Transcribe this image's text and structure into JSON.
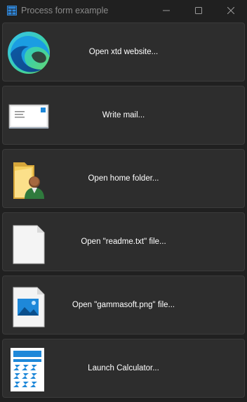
{
  "window": {
    "title": "Process form example",
    "icon": "window-app-icon",
    "controls": [
      "minimize-icon",
      "maximize-icon",
      "close-icon"
    ]
  },
  "buttons": [
    {
      "label": "Open xtd website...",
      "icon": "edge-browser-icon"
    },
    {
      "label": "Write mail...",
      "icon": "envelope-icon"
    },
    {
      "label": "Open home folder...",
      "icon": "user-folder-icon"
    },
    {
      "label": "Open \"readme.txt\" file...",
      "icon": "text-file-icon"
    },
    {
      "label": "Open \"gammasoft.png\" file...",
      "icon": "image-file-icon"
    },
    {
      "label": "Launch Calculator...",
      "icon": "calculator-icon"
    }
  ],
  "colors": {
    "background": "#202020",
    "button_background": "#2d2d2d",
    "button_border": "#3b3b3b",
    "text": "#ffffff",
    "title_text": "#8a8a8a",
    "accent": "#1e88d9"
  }
}
